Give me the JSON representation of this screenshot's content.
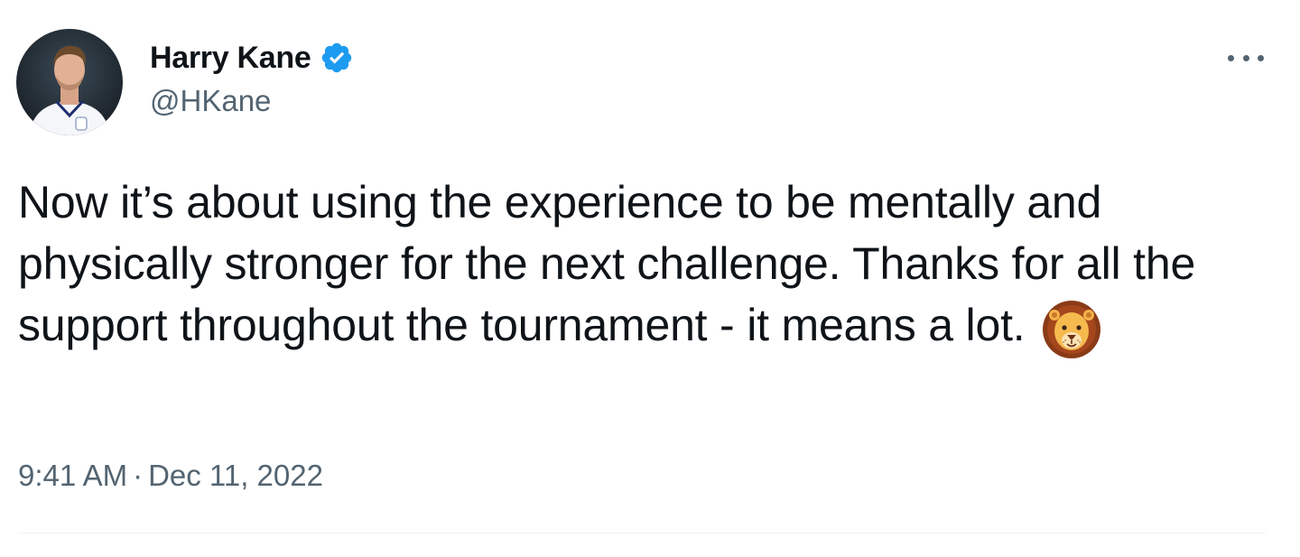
{
  "author": {
    "display_name": "Harry Kane",
    "handle": "@HKane",
    "verified": true,
    "avatar_icon": "profile-photo"
  },
  "tweet": {
    "text": "Now it’s about using the experience to be mentally and physically stronger for the next challenge. Thanks for all the support throughout the tournament - it means a lot.",
    "emoji": "lion-face-icon",
    "time": "9:41 AM",
    "separator": "·",
    "date": "Dec 11, 2022"
  },
  "colors": {
    "text_primary": "#0f1419",
    "text_secondary": "#536471",
    "verified_blue": "#1d9bf0",
    "divider": "#eff3f4"
  },
  "more_menu_icon": "more-horizontal-icon"
}
